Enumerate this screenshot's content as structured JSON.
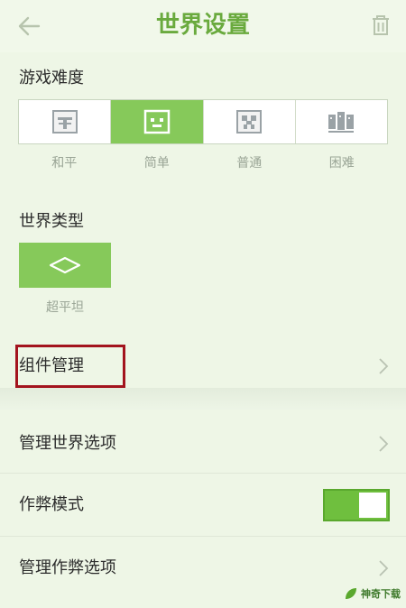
{
  "header": {
    "title": "世界设置",
    "back_icon": "arrow-left-icon",
    "trash_icon": "trash-icon"
  },
  "difficulty": {
    "label": "游戏难度",
    "options": [
      {
        "label": "和平",
        "icon": "peaceful-icon",
        "selected": false
      },
      {
        "label": "简单",
        "icon": "easy-icon",
        "selected": true
      },
      {
        "label": "普通",
        "icon": "creeper-icon",
        "selected": false
      },
      {
        "label": "困难",
        "icon": "hard-icon",
        "selected": false
      }
    ]
  },
  "world_type": {
    "label": "世界类型",
    "selected": "超平坦",
    "icon": "flat-world-icon"
  },
  "rows": {
    "components": "组件管理",
    "world_options": "管理世界选项",
    "cheat_mode": "作弊模式",
    "cheat_options": "管理作弊选项"
  },
  "cheat_mode_enabled": true,
  "watermark": "神奇下载",
  "colors": {
    "accent": "#6aaa3e",
    "selected": "#86c95a",
    "highlight": "#a3141e"
  }
}
